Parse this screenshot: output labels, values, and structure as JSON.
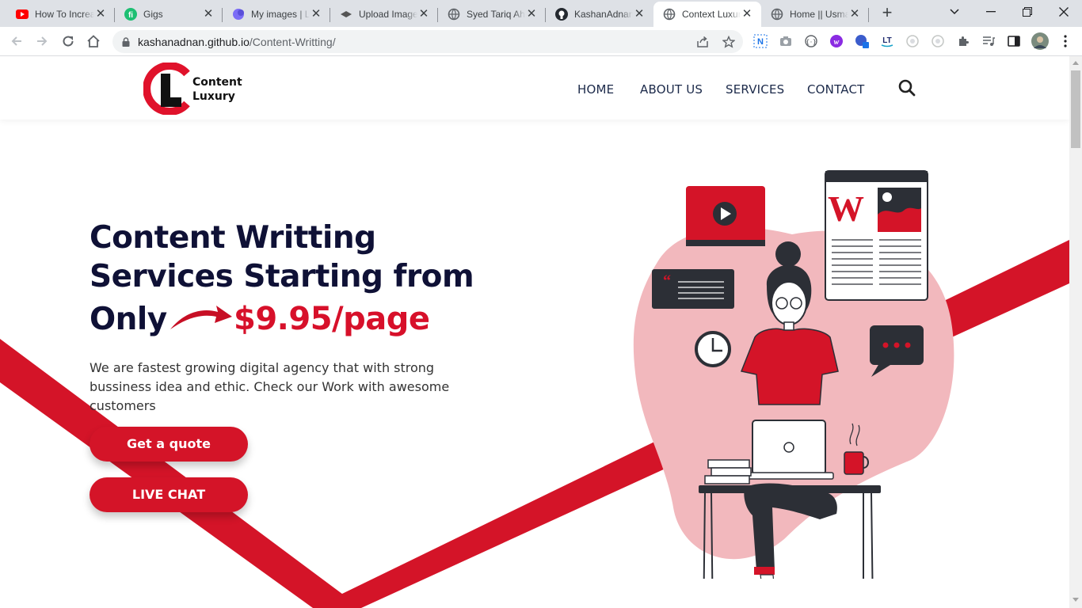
{
  "browser": {
    "tabs": [
      {
        "title": "How To Increase",
        "icon": "youtube-icon",
        "active": false
      },
      {
        "title": "Gigs",
        "icon": "fiverr-icon",
        "active": false
      },
      {
        "title": "My images | L",
        "icon": "image-host-icon",
        "active": false
      },
      {
        "title": "Upload Image",
        "icon": "upload-icon",
        "active": false
      },
      {
        "title": "Syed Tariq Ah",
        "icon": "globe-icon",
        "active": false
      },
      {
        "title": "KashanAdnan",
        "icon": "github-icon",
        "active": false
      },
      {
        "title": "Context Luxury",
        "icon": "globe-icon",
        "active": true
      },
      {
        "title": "Home || Usma",
        "icon": "globe-icon",
        "active": false
      }
    ],
    "url_host": "kashanadnan.github.io",
    "url_path": "/Content-Writting/"
  },
  "site": {
    "logo": {
      "line1": "Content",
      "line2": "Luxury"
    },
    "nav": [
      "HOME",
      "ABOUT US",
      "SERVICES",
      "CONTACT"
    ],
    "hero": {
      "title_line1": "Content Writting",
      "title_line2": "Services Starting from",
      "title_line3": "Only",
      "price": "$9.95/page",
      "description": "We are fastest growing digital agency that with strong bussiness idea and ethic. Check our Work with awesome customers",
      "cta_quote": "Get a quote",
      "cta_chat": "LIVE CHAT"
    },
    "colors": {
      "brand_red": "#d41428",
      "navy": "#0f1136",
      "pink_blob": "#f2b8bd"
    }
  }
}
